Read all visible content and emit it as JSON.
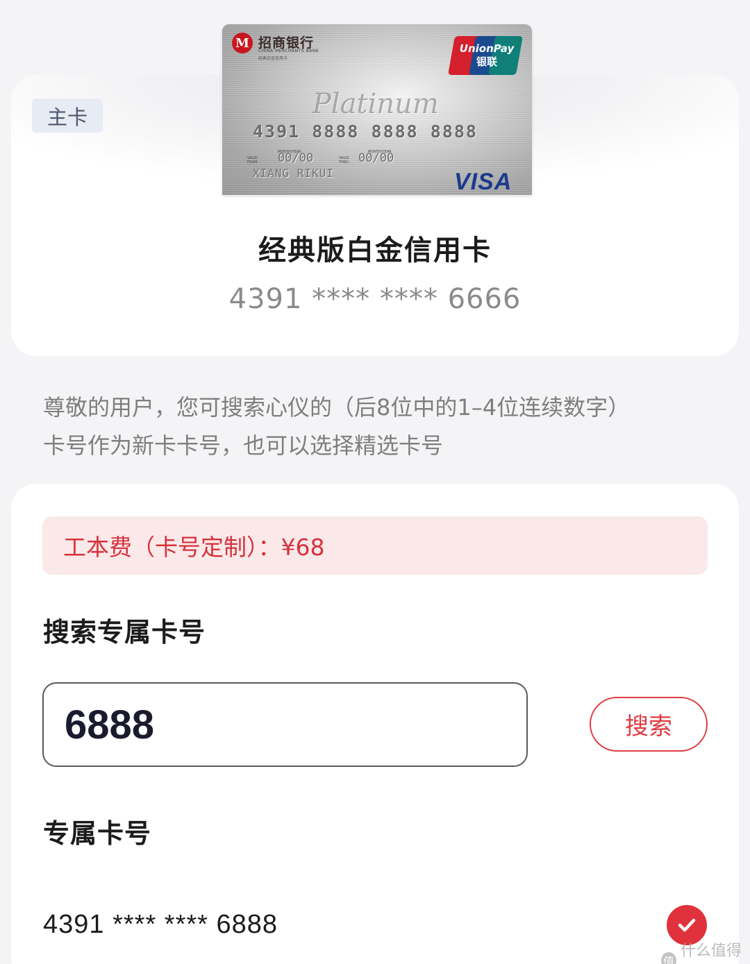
{
  "card": {
    "badge": "主卡",
    "name": "经典版白金信用卡",
    "masked_number": "4391  ****  ****  6666",
    "image": {
      "bank_name_cn": "招商银行",
      "bank_name_en": "CHINA MERCHANTS BANK",
      "bank_sub": "经典白金信用卡",
      "logo_letter": "M",
      "network_top": "UnionPay",
      "network_top_cn": "银联",
      "tier": "Platinum",
      "number": "4391 8888 8888 8888",
      "valid_from_label": "VALID FROM",
      "valid_from": "00/00",
      "valid_thru_label": "VALID THRU",
      "valid_thru": "00/00",
      "month_year_label": "MONTH/YEAR",
      "holder": "XIANG RIKUI",
      "network": "VISA"
    }
  },
  "notice": {
    "line1": "尊敬的用户，您可搜索心仪的（后8位中的1–4位连续数字）",
    "line2": "卡号作为新卡卡号，也可以选择精选卡号"
  },
  "fee": {
    "text": "工本费（卡号定制）：¥68"
  },
  "search": {
    "title": "搜索专属卡号",
    "input_value": "6888",
    "button_label": "搜索"
  },
  "exclusive": {
    "title": "专属卡号",
    "results": [
      {
        "number": "4391  ****  ****  6888",
        "selected": true
      }
    ]
  },
  "watermark": {
    "icon_text": "值",
    "text": "什么值得买"
  },
  "colors": {
    "accent": "#e0323c",
    "fee_bg": "#fbe9ea",
    "page_bg": "#f4f4f6"
  }
}
